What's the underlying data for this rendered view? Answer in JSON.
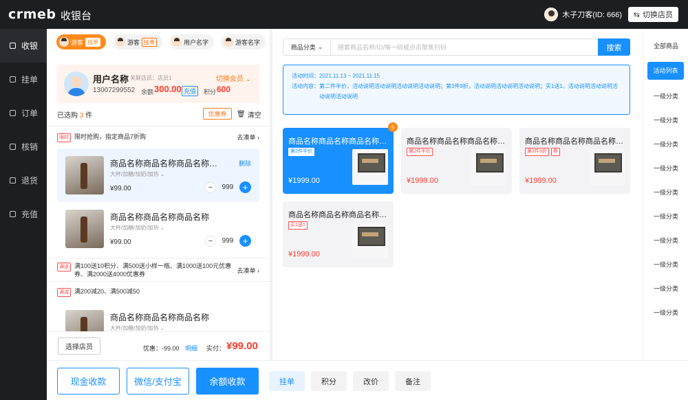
{
  "header": {
    "logo": "crmeb",
    "title": "收银台",
    "user": "木子刀客(ID: 666)",
    "switch_store": "切换店员"
  },
  "sidebar": [
    {
      "label": "收银",
      "active": true
    },
    {
      "label": "挂单"
    },
    {
      "label": "订单"
    },
    {
      "label": "核销"
    },
    {
      "label": "退货"
    },
    {
      "label": "充值"
    }
  ],
  "guest_tabs": [
    {
      "label": "游客",
      "badge": "挂单",
      "active": true
    },
    {
      "label": "游客",
      "badge": "挂单"
    },
    {
      "label": "用户名字"
    },
    {
      "label": "游客名字"
    }
  ],
  "member": {
    "name": "用户名称",
    "store": "关联店员：店员1",
    "switch": "切换会员",
    "phone": "13007299552",
    "balance_label": "余额",
    "balance": "300.00",
    "recharge": "充值",
    "points_label": "积分",
    "points": "600"
  },
  "cart_summary": {
    "prefix": "已选购",
    "count": "3",
    "suffix": "件",
    "coupon": "优惠券",
    "clear": "清空"
  },
  "promos": [
    {
      "tag": "限时",
      "text": "限时抢购，指定商品7折购",
      "link": "去凑单"
    },
    {
      "tag": "满送",
      "text": "满100送10积分、满500送小样一瓶、满1000送100元优惠券、满2000送4000优惠券",
      "link": "去凑单"
    },
    {
      "tag": "满减",
      "text": "满200减20、满500减50"
    }
  ],
  "cart_items": [
    {
      "name": "商品名称商品名称商品名称商品名称",
      "spec": "大杯/加糖/加奶/加热",
      "price": "¥99.00",
      "qty": "999",
      "delete": "删除"
    },
    {
      "name": "商品名称商品名称商品名称",
      "spec": "大杯/加糖/加奶/加热",
      "price": "¥99.00",
      "qty": "999"
    },
    {
      "name": "商品名称商品名称商品名称",
      "spec": "大杯/加糖/加奶/加热"
    }
  ],
  "footer": {
    "store_btn": "选择店员",
    "discount": "优惠：-99.00",
    "detail": "明细",
    "paid_label": "实付：",
    "paid": "¥99.00"
  },
  "pay": {
    "cash": "现金收款",
    "wechat": "微信/支付宝",
    "balance": "余额收款"
  },
  "actions": {
    "hold": "挂单",
    "points": "积分",
    "price": "改价",
    "note": "备注"
  },
  "search": {
    "category": "商品分类",
    "placeholder": "搜索商品名称/ID/唯一码或点击聚焦扫码",
    "button": "搜索"
  },
  "activity": {
    "time_label": "活动时间：",
    "time": "2021.11.13 ~ 2021.11.15",
    "content_label": "活动内容：",
    "content": "第二件半价，活动说明活动说明活动说明活动说明；第3件9折，活动说明活动说明活动说明；买1送1，活动说明活动说明活动说明活动说明"
  },
  "products": [
    {
      "name": "商品名称商品名称商品名称商品名称",
      "tags": [
        "第2件半价"
      ],
      "price": "¥1999.00",
      "badge": "5",
      "selected": true
    },
    {
      "name": "商品名称商品名称商品名称商品名称",
      "tags": [
        "第2件半价"
      ],
      "price": "¥1999.00"
    },
    {
      "name": "商品名称商品名称商品名称商品名称",
      "tags": [
        "第3件9折",
        "券"
      ],
      "price": "¥1999.00"
    },
    {
      "name": "商品名称商品名称商品名称商品名称",
      "tags": [
        "买1送1"
      ],
      "price": "¥1999.00"
    }
  ],
  "categories": [
    {
      "label": "全部商品"
    },
    {
      "label": "活动列表",
      "active": true
    },
    {
      "label": "一级分类"
    },
    {
      "label": "一级分类"
    },
    {
      "label": "一级分类"
    },
    {
      "label": "一级分类"
    },
    {
      "label": "一级分类"
    },
    {
      "label": "一级分类"
    },
    {
      "label": "一级分类"
    },
    {
      "label": "一级分类"
    },
    {
      "label": "一级分类"
    },
    {
      "label": "一级分类"
    }
  ],
  "colors": {
    "primary": "#1890ff",
    "accent": "#ff7a1a",
    "price": "#ff3b30",
    "dark": "#1d1e22"
  }
}
